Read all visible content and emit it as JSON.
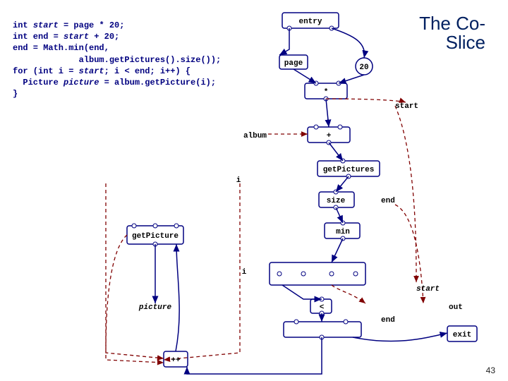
{
  "title_l1": "The Co-",
  "title_l2": "Slice",
  "page_number": "43",
  "code_lines": [
    "int <i>start</i> = page * 20;",
    "int end = <i>start</i> + 20;",
    "end = Math.min(end,",
    "             album.getPictures().size());",
    "for (int i = <i>start</i>; i < end; i++) {",
    "  Picture <i>picture</i> = album.getPicture(i);",
    "}"
  ],
  "nodes": {
    "entry": "entry",
    "page": "page",
    "twenty": "20",
    "star": "*",
    "start": "start",
    "plus": "+",
    "album": "album",
    "getPictures": "getPictures",
    "i_lbl": "i",
    "size": "size",
    "end1": "end",
    "min": "min",
    "getPicture": "getPicture",
    "i2": "i",
    "picture": "picture",
    "lt": "<",
    "end2": "end",
    "start2": "start",
    "out": "out",
    "exit": "exit",
    "pp": "++"
  }
}
